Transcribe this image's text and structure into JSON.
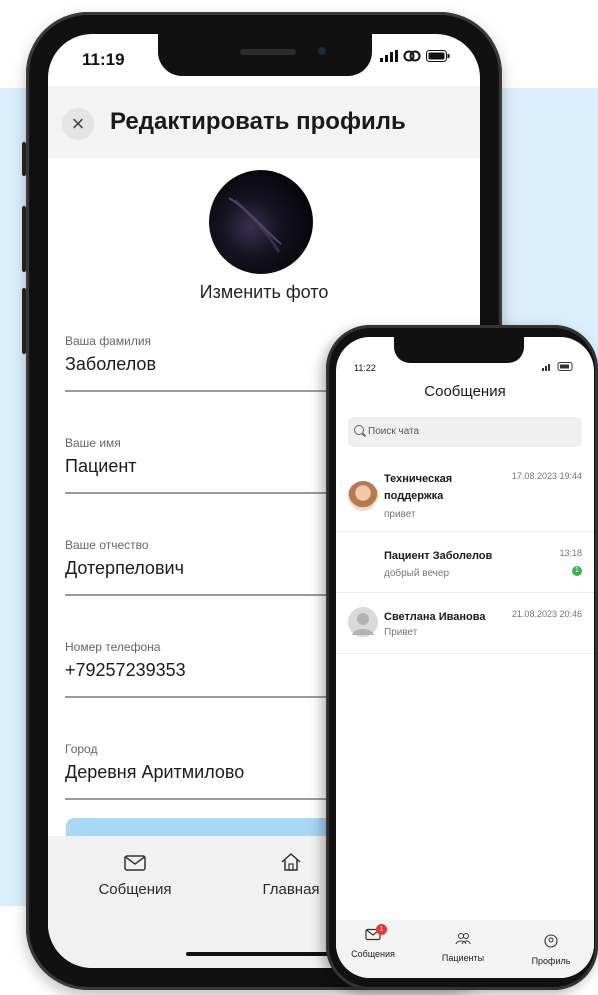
{
  "main_phone": {
    "status": {
      "time": "11:19"
    },
    "header": {
      "title": "Редактировать профиль",
      "close_icon": "close-icon"
    },
    "avatar": {
      "change_photo_label": "Изменить фото"
    },
    "fields": [
      {
        "label": "Ваша фамилия",
        "value": "Заболелов"
      },
      {
        "label": "Ваше имя",
        "value": "Пациент"
      },
      {
        "label": "Ваше отчество",
        "value": "Дотерпелович"
      },
      {
        "label": "Номер телефона",
        "value": "+79257239353"
      },
      {
        "label": "Город",
        "value": "Деревня Аритмилово"
      }
    ],
    "tabs": [
      {
        "label": "Собщения",
        "icon": "envelope-icon"
      },
      {
        "label": "Главная",
        "icon": "home-icon"
      }
    ]
  },
  "secondary_phone": {
    "status": {
      "time": "11:22"
    },
    "title": "Сообщения",
    "search": {
      "placeholder": "Поиск чата"
    },
    "chats": [
      {
        "name": "Техническая поддержка",
        "preview": "привет",
        "date": "17.08.2023 19:44"
      },
      {
        "name": "Пациент Заболелов",
        "preview": "добрый вечер",
        "date": "13:18",
        "unread": "1"
      },
      {
        "name": "Светлана Иванова",
        "preview": "Привет",
        "date": "21.08.2023 20:46"
      }
    ],
    "tabs": [
      {
        "label": "Собщения",
        "icon": "envelope-icon",
        "badge": "1"
      },
      {
        "label": "Пациенты",
        "icon": "people-icon"
      },
      {
        "label": "Профиль",
        "icon": "profile-icon"
      }
    ],
    "colors": {
      "unread_badge": "#3cb34a",
      "tab_badge": "#e53935"
    }
  },
  "colors": {
    "background_panel": "#dbeefb",
    "save_button": "#a9d7f6"
  }
}
